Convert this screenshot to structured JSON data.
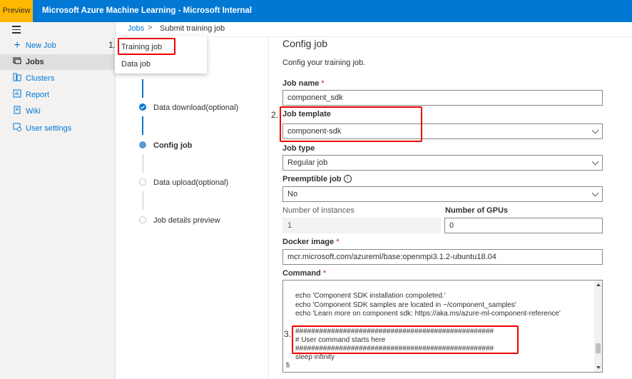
{
  "topbar": {
    "preview": "Preview",
    "title": "Microsoft Azure Machine Learning - Microsoft Internal"
  },
  "nav": {
    "items": [
      {
        "label": "New Job",
        "icon": "plus-icon"
      },
      {
        "label": "Jobs",
        "icon": "jobs-icon",
        "active": true
      },
      {
        "label": "Clusters",
        "icon": "clusters-icon"
      },
      {
        "label": "Report",
        "icon": "report-icon"
      },
      {
        "label": "Wiki",
        "icon": "wiki-icon"
      },
      {
        "label": "User settings",
        "icon": "user-settings-icon"
      }
    ]
  },
  "breadcrumb": {
    "jobs": "Jobs",
    "sep": ">",
    "current": "Submit training job"
  },
  "dropdown": {
    "items": [
      "Training job",
      "Data job"
    ]
  },
  "annotations": {
    "a1": "1.",
    "a2": "2.",
    "a3": "3."
  },
  "steps": [
    {
      "label": "Data download(optional)",
      "state": "done"
    },
    {
      "label": "Config job",
      "state": "active"
    },
    {
      "label": "Data upload(optional)",
      "state": "pending"
    },
    {
      "label": "Job details preview",
      "state": "pending"
    }
  ],
  "config": {
    "title": "Config job",
    "subtitle": "Config your training job.",
    "job_name_label": "Job name",
    "job_name_value": "component_sdk",
    "job_template_label": "Job template",
    "job_template_value": "component-sdk",
    "job_type_label": "Job type",
    "job_type_value": "Regular job",
    "preemptible_label": "Preemptible job",
    "preemptible_value": "No",
    "instances_label": "Number of instances",
    "instances_value": "1",
    "gpus_label": "Number of GPUs",
    "gpus_value": "0",
    "docker_label": "Docker image",
    "docker_value": "mcr.microsoft.com/azureml/base:openmpi3.1.2-ubuntu18.04",
    "command_label": "Command",
    "required_mark": "*",
    "info_glyph": "i"
  },
  "command_lines": [
    "echo 'Component SDK installation compoleted.'",
    "echo 'Component SDK samples are located in ~/component_samples'",
    "echo 'Learn more on component sdk: https://aka.ms/azure-ml-component-reference'",
    "",
    "##################################################",
    "# User command starts here",
    "##################################################",
    "sleep infinity",
    "fi"
  ],
  "colors": {
    "brand": "#0078d4",
    "preview": "#ffb900",
    "annotation": "#e00000"
  }
}
